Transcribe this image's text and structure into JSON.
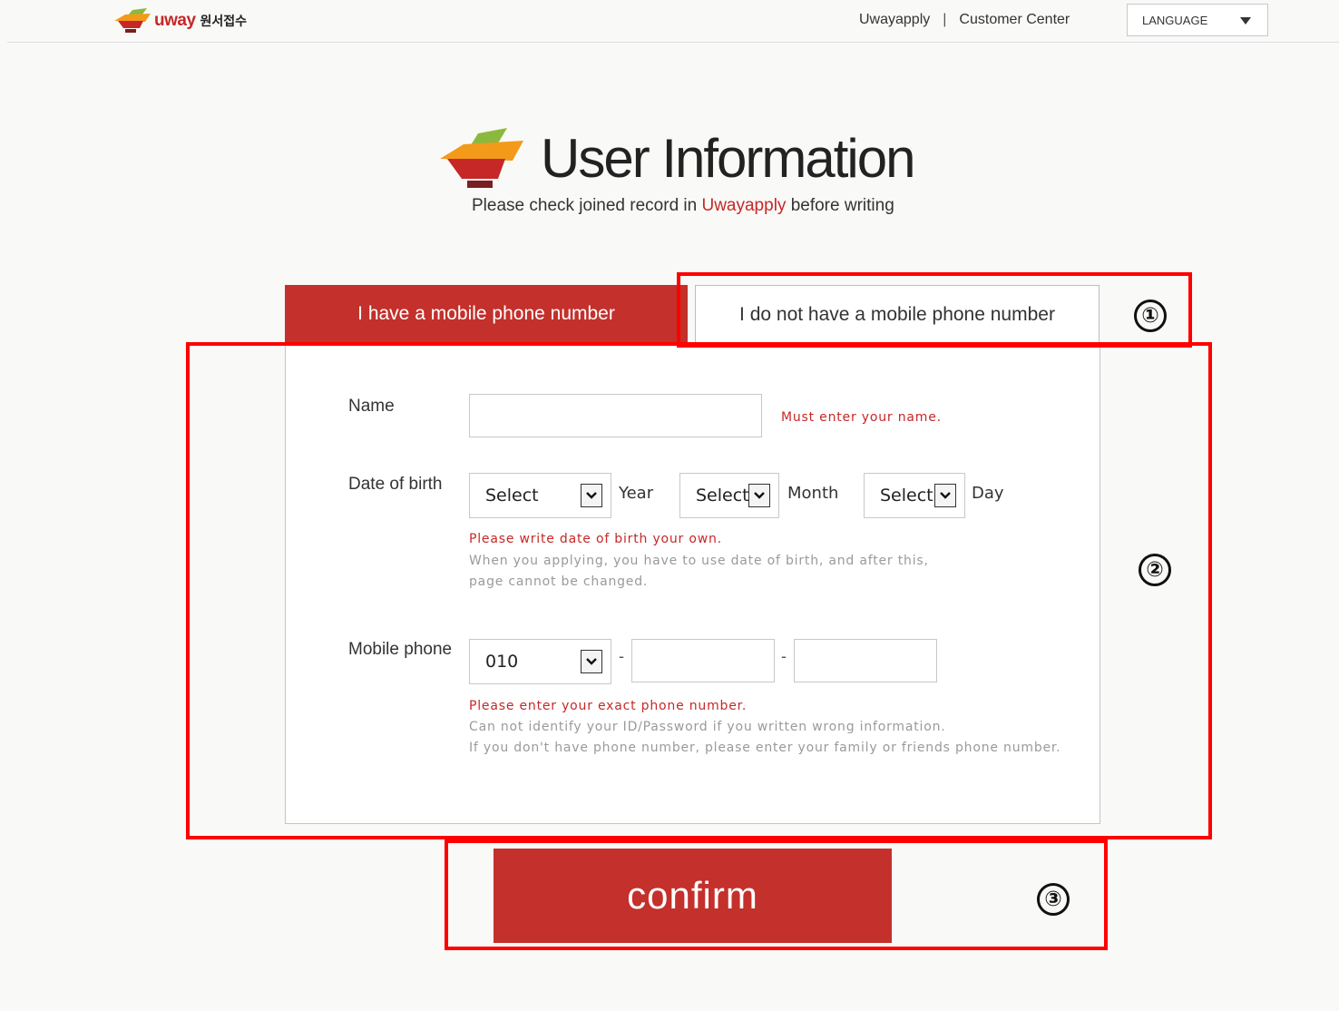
{
  "header": {
    "brand": "uway",
    "brand_sub": "원서접수",
    "links": [
      "Uwayapply",
      "Customer Center"
    ],
    "separator": "|",
    "language_label": "LANGUAGE"
  },
  "hero": {
    "title": "User Information",
    "subtitle_before": "Please check joined record in ",
    "subtitle_accent": "Uwayapply",
    "subtitle_after": " before writing"
  },
  "tabs": [
    {
      "label": "I have a mobile phone number",
      "active": true
    },
    {
      "label": "I do not have a mobile phone number",
      "active": false
    }
  ],
  "form": {
    "name": {
      "label": "Name",
      "value": "",
      "error": "Must enter your name."
    },
    "dob": {
      "label": "Date of birth",
      "year": {
        "selected": "Select",
        "unit": "Year"
      },
      "month": {
        "selected": "Select",
        "unit": "Month"
      },
      "day": {
        "selected": "Select",
        "unit": "Day"
      },
      "error": "Please write date of birth your own.",
      "hint_lines": [
        "When you applying, you have to use date of birth, and after this,",
        "page cannot be changed."
      ]
    },
    "phone": {
      "label": "Mobile phone",
      "prefix_selected": "010",
      "dash": "-",
      "middle": "",
      "last": "",
      "error": "Please enter your exact phone number.",
      "hint_lines": [
        "Can not identify your ID/Password if you written wrong information.",
        "If you don't have phone number, please enter your family or friends phone number."
      ]
    }
  },
  "confirm_label": "confirm",
  "annotations": [
    "①",
    "②",
    "③"
  ],
  "colors": {
    "accent": "#c4302b",
    "error_text": "#c62828",
    "annotation": "#ff0000",
    "background": "#f9f9f7"
  }
}
